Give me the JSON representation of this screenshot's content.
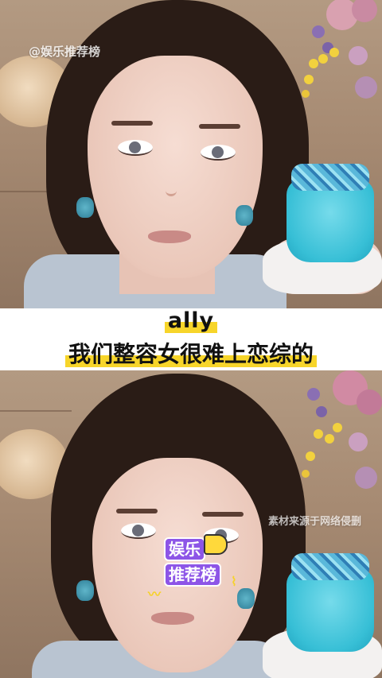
{
  "watermark_top_left": "@娱乐推荐榜",
  "caption": {
    "line1": "ally",
    "line2": "我们整容女很难上恋综的"
  },
  "watermark_bottom_right": "素材来源于网络侵删",
  "sticker": {
    "line1": "娱乐",
    "line2": "推荐榜"
  },
  "colors": {
    "caption_highlight": "#f7d52a",
    "sticker_purple": "#8d55e7",
    "cake_blue": "#37bfd6"
  }
}
